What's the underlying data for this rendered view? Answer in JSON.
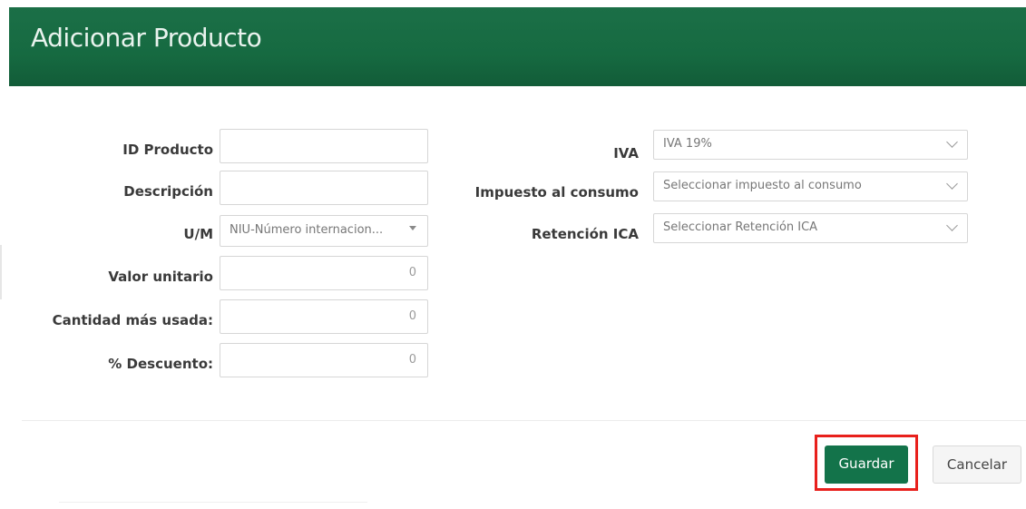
{
  "dialog": {
    "title": "Adicionar Producto"
  },
  "left_form": {
    "id_label": "ID Producto",
    "id_value": "",
    "desc_label": "Descripción",
    "desc_value": "",
    "um_label": "U/M",
    "um_value": "NIU-Número internacion...",
    "price_label": "Valor unitario",
    "price_value": "0",
    "qty_label": "Cantidad más usada:",
    "qty_value": "0",
    "discount_label": "% Descuento:",
    "discount_value": "0"
  },
  "right_form": {
    "iva_label": "IVA",
    "iva_value": "IVA 19%",
    "consumo_label": "Impuesto al consumo",
    "consumo_value": "Seleccionar impuesto al consumo",
    "ica_label": "Retención ICA",
    "ica_value": "Seleccionar Retención ICA"
  },
  "footer": {
    "save_label": "Guardar",
    "cancel_label": "Cancelar"
  },
  "colors": {
    "header": "#166a41",
    "save_button": "#13734a",
    "highlight": "#e8201c"
  }
}
